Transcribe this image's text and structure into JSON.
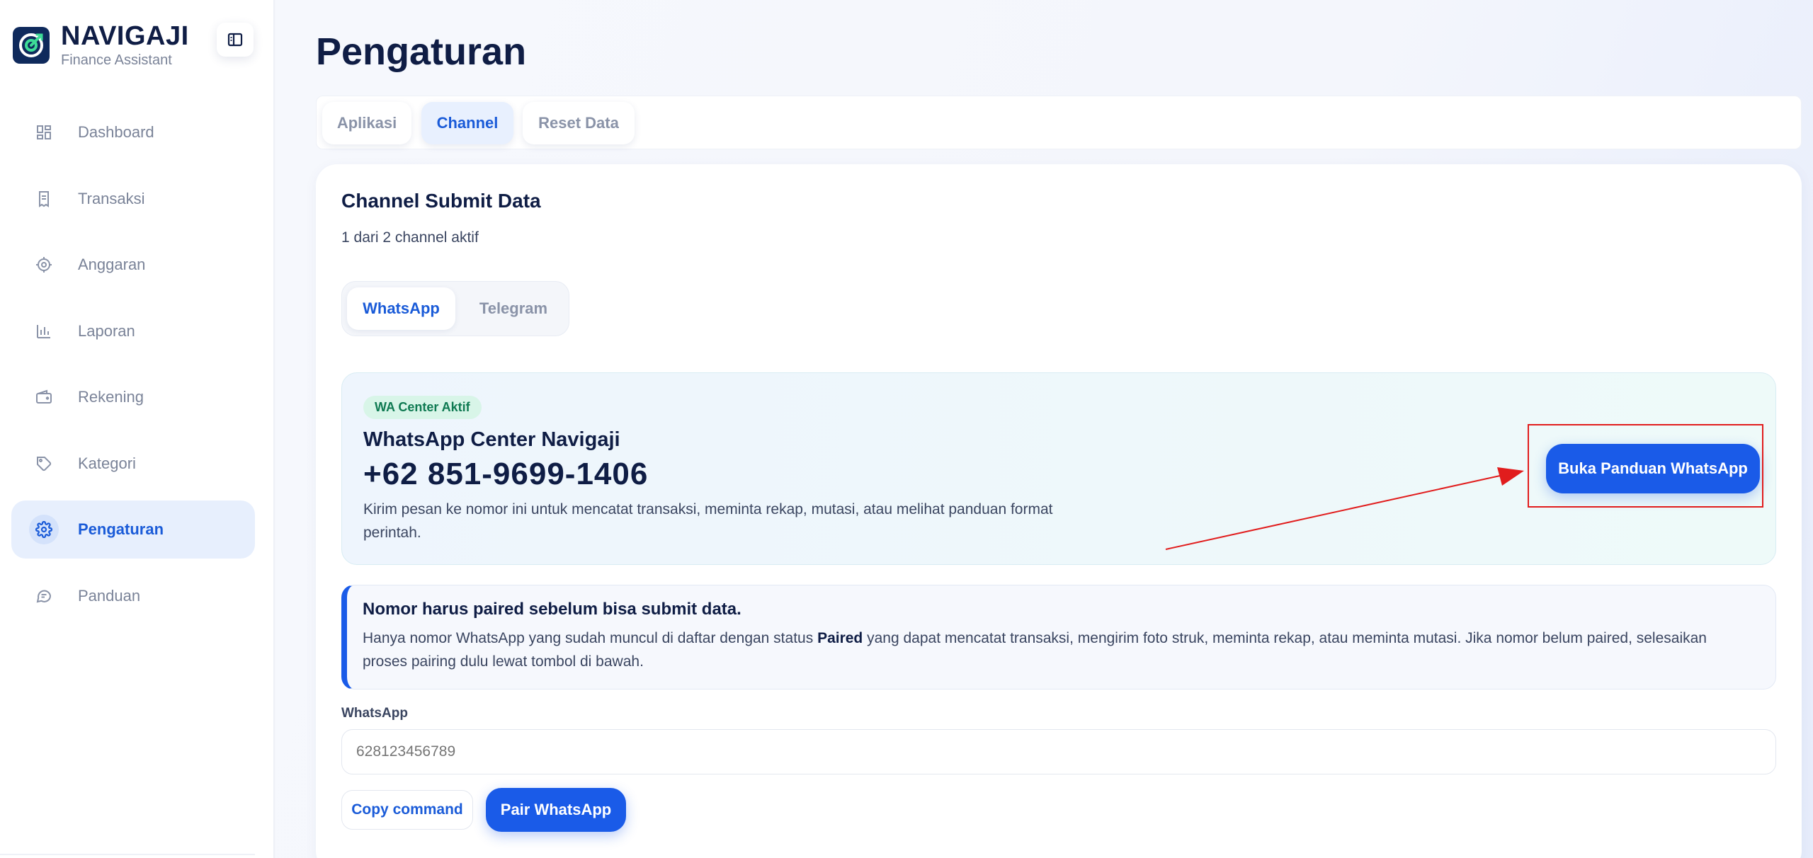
{
  "brand": {
    "name": "NAVIGAJI",
    "subtitle": "Finance Assistant"
  },
  "sidebar": {
    "items": [
      {
        "label": "Dashboard",
        "icon": "dashboard-icon"
      },
      {
        "label": "Transaksi",
        "icon": "receipt-icon"
      },
      {
        "label": "Anggaran",
        "icon": "target-icon"
      },
      {
        "label": "Laporan",
        "icon": "bar-chart-icon"
      },
      {
        "label": "Rekening",
        "icon": "wallet-icon"
      },
      {
        "label": "Kategori",
        "icon": "tag-icon"
      },
      {
        "label": "Pengaturan",
        "icon": "gear-icon",
        "active": true
      },
      {
        "label": "Panduan",
        "icon": "chat-icon"
      }
    ]
  },
  "page": {
    "title": "Pengaturan"
  },
  "tabs": [
    {
      "label": "Aplikasi"
    },
    {
      "label": "Channel",
      "active": true
    },
    {
      "label": "Reset Data"
    }
  ],
  "channel": {
    "title": "Channel Submit Data",
    "subtitle": "1 dari 2 channel aktif",
    "segments": [
      {
        "label": "WhatsApp",
        "active": true
      },
      {
        "label": "Telegram"
      }
    ]
  },
  "wa_center": {
    "badge": "WA Center Aktif",
    "name": "WhatsApp Center Navigaji",
    "number": "+62 851-9699-1406",
    "description": "Kirim pesan ke nomor ini untuk mencatat transaksi, meminta rekap, mutasi, atau melihat panduan format perintah.",
    "guide_button": "Buka Panduan WhatsApp"
  },
  "notice": {
    "title": "Nomor harus paired sebelum bisa submit data.",
    "text_before": "Hanya nomor WhatsApp yang sudah muncul di daftar dengan status ",
    "text_bold": "Paired",
    "text_after": " yang dapat mencatat transaksi, mengirim foto struk, meminta rekap, atau meminta mutasi. Jika nomor belum paired, selesaikan proses pairing dulu lewat tombol di bawah."
  },
  "form": {
    "label": "WhatsApp",
    "placeholder": "628123456789",
    "copy_button": "Copy command",
    "pair_button": "Pair WhatsApp"
  },
  "colors": {
    "accent": "#1a5be8",
    "annotation": "#e11d1d",
    "badge_bg": "#d8f5e8",
    "badge_text": "#0f7a52"
  }
}
